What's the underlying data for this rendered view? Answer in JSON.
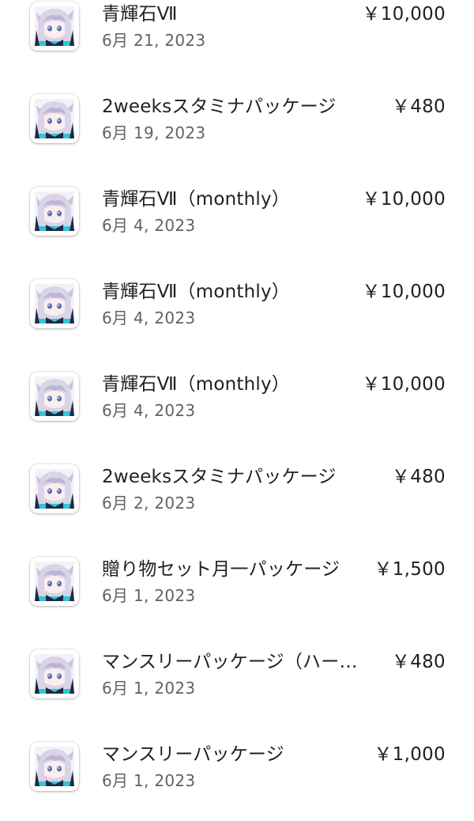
{
  "purchases": [
    {
      "title": "青輝石Ⅶ",
      "date": "6月 21, 2023",
      "price": "￥10,000",
      "icon": "game-character-icon"
    },
    {
      "title": "2weeksスタミナパッケージ",
      "date": "6月 19, 2023",
      "price": "￥480",
      "icon": "game-character-icon"
    },
    {
      "title": "青輝石Ⅶ（monthly）",
      "date": "6月 4, 2023",
      "price": "￥10,000",
      "icon": "game-character-icon"
    },
    {
      "title": "青輝石Ⅶ（monthly）",
      "date": "6月 4, 2023",
      "price": "￥10,000",
      "icon": "game-character-icon"
    },
    {
      "title": "青輝石Ⅶ（monthly）",
      "date": "6月 4, 2023",
      "price": "￥10,000",
      "icon": "game-character-icon"
    },
    {
      "title": "2weeksスタミナパッケージ",
      "date": "6月 2, 2023",
      "price": "￥480",
      "icon": "game-character-icon"
    },
    {
      "title": "贈り物セット月一パッケージ",
      "date": "6月 1, 2023",
      "price": "￥1,500",
      "icon": "game-character-icon"
    },
    {
      "title": "マンスリーパッケージ（ハー…",
      "date": "6月 1, 2023",
      "price": "￥480",
      "icon": "game-character-icon"
    },
    {
      "title": "マンスリーパッケージ",
      "date": "6月 1, 2023",
      "price": "￥1,000",
      "icon": "game-character-icon"
    }
  ],
  "colors": {
    "primary_text": "#202124",
    "secondary_text": "#5f6368",
    "background": "#ffffff",
    "icon_hair": "#d9d4e6",
    "icon_scarf": "#2fc6d6"
  }
}
